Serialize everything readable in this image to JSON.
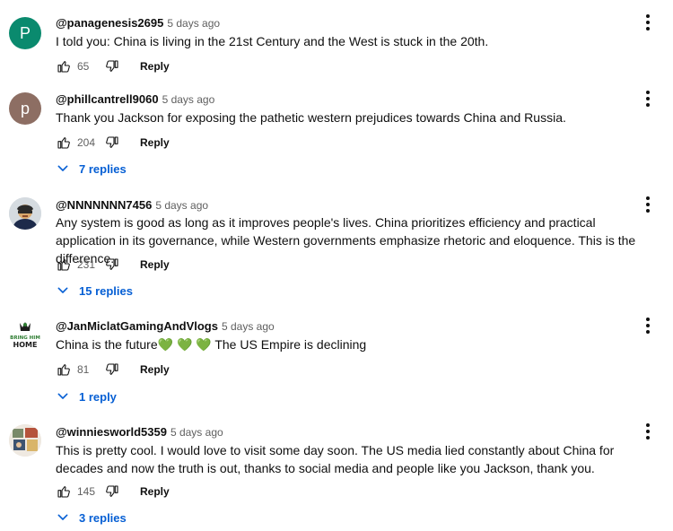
{
  "comments": [
    {
      "author": "@panagenesis2695",
      "time": "5 days ago",
      "avatar_letter": "P",
      "avatar_color": "#0a8a6e",
      "text": "I told you: China is living in the 21st Century and the West is stuck in the 20th.",
      "likes": "65",
      "reply_label": "Reply"
    },
    {
      "author": "@phillcantrell9060",
      "time": "5 days ago",
      "avatar_letter": "p",
      "avatar_color": "#8d6e63",
      "text": "Thank you Jackson for exposing the pathetic western prejudices towards China and Russia.",
      "likes": "204",
      "reply_label": "Reply",
      "replies_label": "7 replies"
    },
    {
      "author": "@NNNNNNN7456",
      "time": "5 days ago",
      "avatar_icon": "cartoon-character-avatar",
      "text": "Any system is good as long as it improves people's lives. China prioritizes efficiency and practical application in its governance, while Western governments emphasize rhetoric and eloquence. This is the difference.",
      "likes": "231",
      "reply_label": "Reply",
      "replies_label": "15 replies"
    },
    {
      "author": "@JanMiclatGamingAndVlogs",
      "time": "5 days ago",
      "avatar_icon": "bring-him-home-logo",
      "avatar_text": "BRING HIM HOME",
      "text_before": "China is the future",
      "emojis": "💚 💚 💚",
      "text_after": " The US Empire is declining",
      "likes": "81",
      "reply_label": "Reply",
      "replies_label": "1 reply"
    },
    {
      "author": "@winniesworld5359",
      "time": "5 days ago",
      "avatar_icon": "photo-collage-avatar",
      "text": "This is pretty cool. I would love to visit some day soon. The US media lied constantly about China for decades and now the truth is out, thanks to social media and people like you Jackson, thank you.",
      "likes": "145",
      "reply_label": "Reply",
      "replies_label": "3 replies"
    }
  ],
  "colors": {
    "link_blue": "#065fd4",
    "secondary_text": "#606060",
    "heart_green": "#5cbf3a"
  }
}
